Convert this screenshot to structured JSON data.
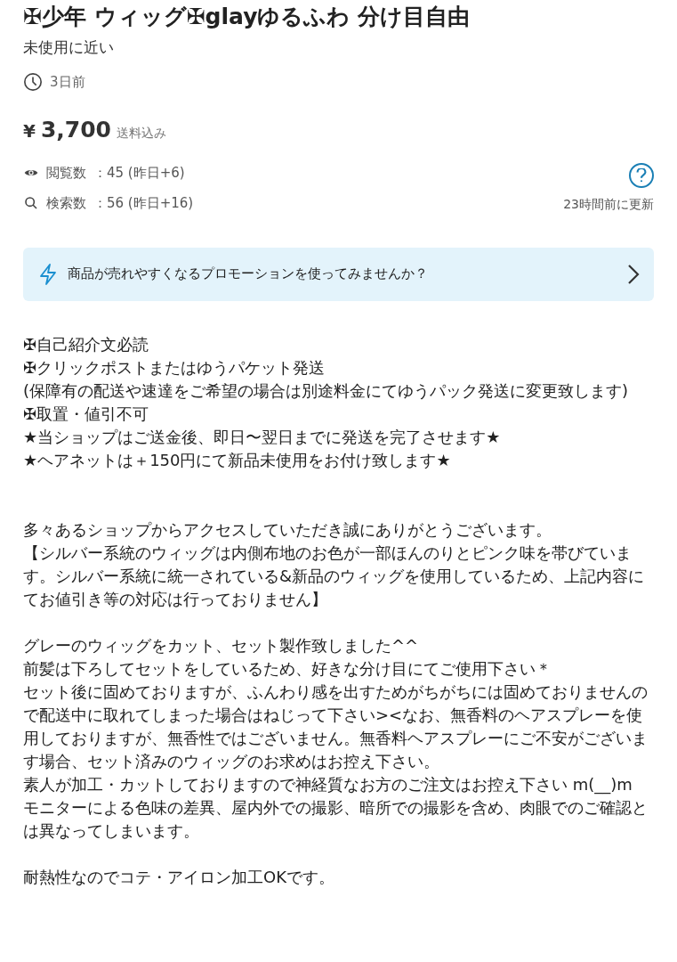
{
  "title": "✠少年 ウィッグ✠glayゆるふわ 分け目自由",
  "condition": "未使用に近い",
  "posted": "3日前",
  "price": {
    "currency": "¥",
    "amount": "3,700",
    "shipping": "送料込み"
  },
  "stats": [
    {
      "kind": "views",
      "label": "閲覧数",
      "value": "：45 (昨日+6)"
    },
    {
      "kind": "searches",
      "label": "検索数",
      "value": "：56 (昨日+16)"
    }
  ],
  "updated": "23時間前に更新",
  "promotion": {
    "text": "商品が売れやすくなるプロモーションを使ってみませんか？"
  },
  "description": [
    {
      "kind": "text",
      "text": "✠自己紹介文必読"
    },
    {
      "kind": "text",
      "text": "✠クリックポストまたはゆうパケット発送"
    },
    {
      "kind": "text",
      "text": "(保障有の配送や速達をご希望の場合は別途料金にてゆうパック発送に変更致します)"
    },
    {
      "kind": "text",
      "text": "✠取置・値引不可"
    },
    {
      "kind": "text",
      "text": "★当ショップはご送金後、即日〜翌日までに発送を完了させます★"
    },
    {
      "kind": "text",
      "text": "★ヘアネットは＋150円にて新品未使用をお付け致します★"
    },
    {
      "kind": "blank"
    },
    {
      "kind": "blank"
    },
    {
      "kind": "text",
      "text": "多々あるショップからアクセスしていただき誠にありがとうございます。"
    },
    {
      "kind": "text",
      "text": "【シルバー系統のウィッグは内側布地のお色が一部ほんのりとピンク味を帯びています。シルバー系統に統一されている&新品のウィッグを使用しているため、上記内容にてお値引き等の対応は行っておりません】"
    },
    {
      "kind": "blank"
    },
    {
      "kind": "text",
      "text": "グレーのウィッグをカット、セット製作致しました^^"
    },
    {
      "kind": "text",
      "text": "前髪は下ろしてセットをしているため、好きな分け目にてご使用下さい＊"
    },
    {
      "kind": "text",
      "text": "セット後に固めておりますが、ふんわり感を出すためがちがちには固めておりませんので配送中に取れてしまった場合はねじって下さい><なお、無香料のヘアスプレーを使用しておりますが、無香性ではございません。無香料ヘアスプレーにご不安がございます場合、セット済みのウィッグのお求めはお控え下さい。"
    },
    {
      "kind": "text",
      "text": "素人が加工・カットしておりますので神経質なお方のご注文はお控え下さい m(__)m"
    },
    {
      "kind": "text",
      "text": "モニターによる色味の差異、屋内外での撮影、暗所での撮影を含め、肉眼でのご確認とは異なってしまいます。"
    },
    {
      "kind": "blank"
    },
    {
      "kind": "text",
      "text": "耐熱性なのでコテ・アイロン加工OKです。"
    }
  ]
}
